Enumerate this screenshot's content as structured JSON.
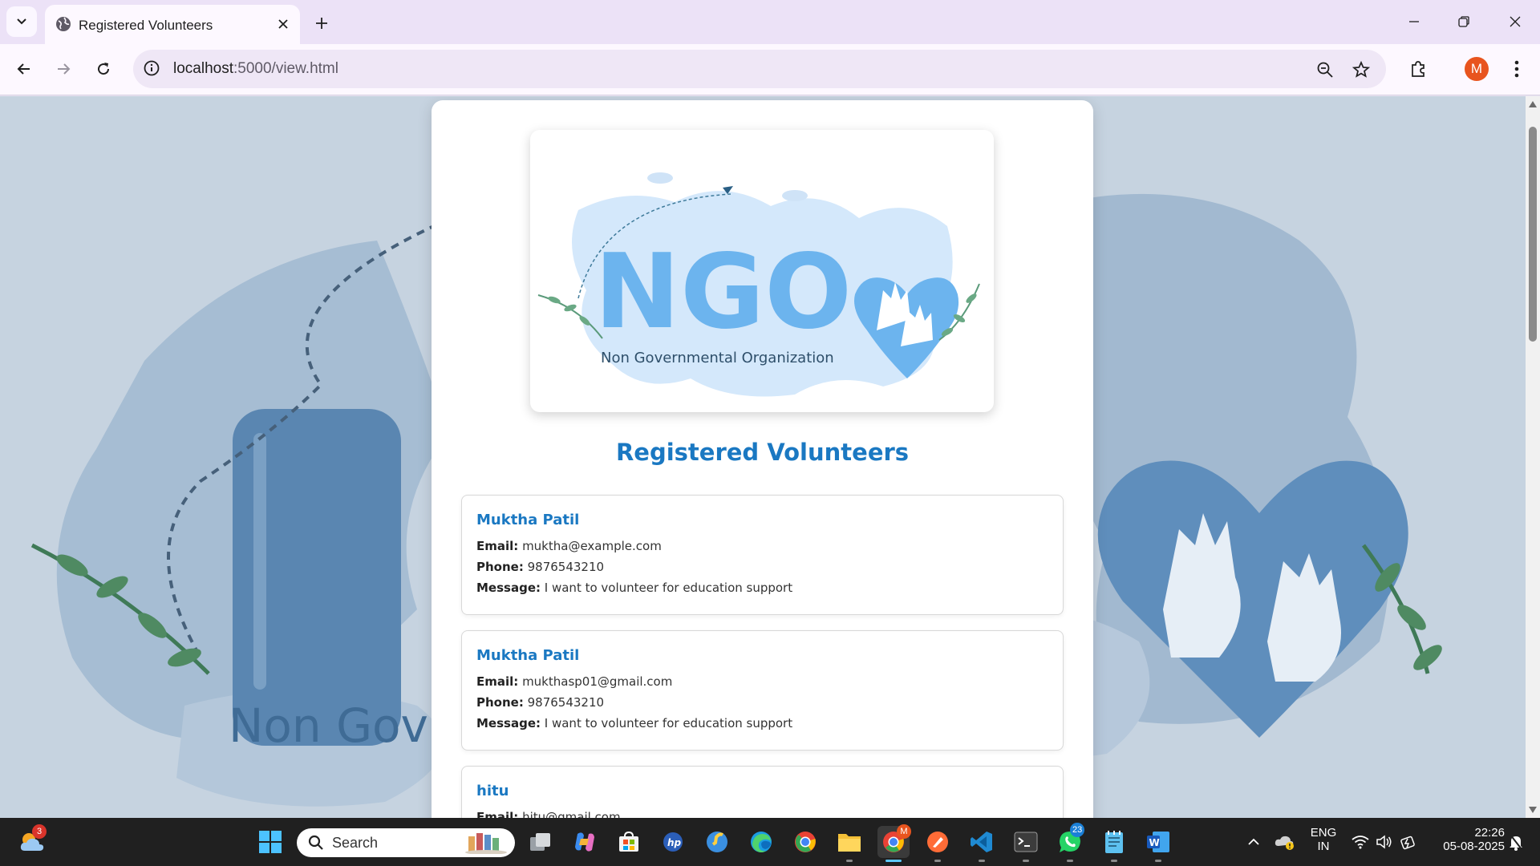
{
  "browser": {
    "tab_title": "Registered Volunteers",
    "url_host": "localhost",
    "url_path": ":5000/view.html",
    "profile_initial": "M"
  },
  "page": {
    "logo": {
      "wordmark": "NGO",
      "subtitle": "Non Governmental Organization"
    },
    "background_text": "Non Gov",
    "heading": "Registered Volunteers",
    "labels": {
      "email": "Email:",
      "phone": "Phone:",
      "message": "Message:"
    },
    "volunteers": [
      {
        "name": "Muktha Patil",
        "email": "muktha@example.com",
        "phone": "9876543210",
        "message": "I want to volunteer for education support"
      },
      {
        "name": "Muktha Patil",
        "email": "mukthasp01@gmail.com",
        "phone": "9876543210",
        "message": "I want to volunteer for education support"
      },
      {
        "name": "hitu",
        "email": "hitu@gmail.com"
      }
    ]
  },
  "taskbar": {
    "weather_badge": "3",
    "search_label": "Search",
    "whatsapp_badge": "23",
    "chrome_badge": "M",
    "language": "ENG",
    "region": "IN",
    "time": "22:26",
    "date": "05-08-2025"
  },
  "colors": {
    "accent": "#1a78c2",
    "logo_blue": "#6fb6f0",
    "tab_bar": "#ece2f7"
  }
}
